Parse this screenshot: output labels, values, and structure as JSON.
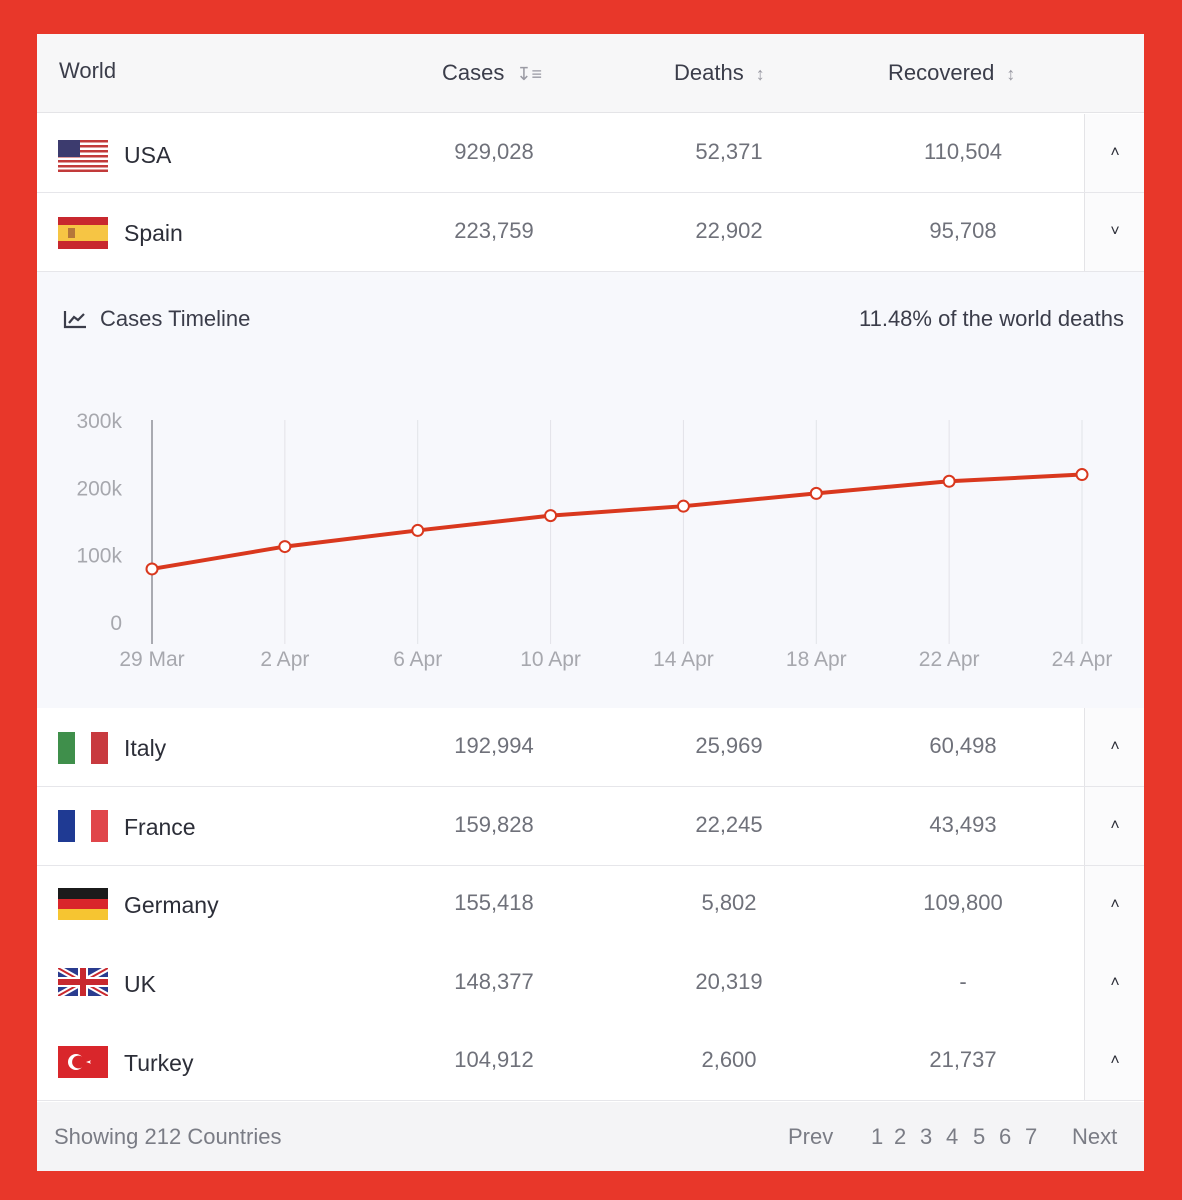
{
  "header": {
    "world": "World",
    "cases": "Cases",
    "deaths": "Deaths",
    "recovered": "Recovered",
    "cases_sort_icon": "sort-descending-icon",
    "deaths_sort_icon": "sort-icon",
    "recovered_sort_icon": "sort-icon"
  },
  "rows": [
    {
      "country": "USA",
      "cases": "929,028",
      "deaths": "52,371",
      "recovered": "110,504",
      "toggle": "˄",
      "flag": "usa-flag-icon"
    },
    {
      "country": "Spain",
      "cases": "223,759",
      "deaths": "22,902",
      "recovered": "95,708",
      "toggle": "˅",
      "flag": "spain-flag-icon"
    },
    {
      "country": "Italy",
      "cases": "192,994",
      "deaths": "25,969",
      "recovered": "60,498",
      "toggle": "˄",
      "flag": "italy-flag-icon"
    },
    {
      "country": "France",
      "cases": "159,828",
      "deaths": "22,245",
      "recovered": "43,493",
      "toggle": "˄",
      "flag": "france-flag-icon"
    },
    {
      "country": "Germany",
      "cases": "155,418",
      "deaths": "5,802",
      "recovered": "109,800",
      "toggle": "˄",
      "flag": "germany-flag-icon"
    },
    {
      "country": "UK",
      "cases": "148,377",
      "deaths": "20,319",
      "recovered": "-",
      "toggle": "˄",
      "flag": "uk-flag-icon"
    },
    {
      "country": "Turkey",
      "cases": "104,912",
      "deaths": "2,600",
      "recovered": "21,737",
      "toggle": "˄",
      "flag": "turkey-flag-icon"
    }
  ],
  "timeline": {
    "title": "Cases Timeline",
    "icon": "line-chart-icon",
    "stat": "11.48% of the world deaths"
  },
  "chart_data": {
    "type": "line",
    "title": "",
    "xlabel": "",
    "ylabel": "",
    "x": [
      "29 Mar",
      "2 Apr",
      "6 Apr",
      "10 Apr",
      "14 Apr",
      "18 Apr",
      "22 Apr",
      "24 Apr"
    ],
    "y_ticks": [
      "0",
      "100k",
      "200k",
      "300k"
    ],
    "ylim": [
      0,
      300000
    ],
    "series": [
      {
        "values": [
          78800,
          112000,
          136000,
          158000,
          172000,
          191000,
          209000,
          219000
        ]
      }
    ],
    "grid": true,
    "color": "#d9381e"
  },
  "footer": {
    "showing": "Showing 212 Countries",
    "prev": "Prev",
    "pages": [
      "1",
      "2",
      "3",
      "4",
      "5",
      "6",
      "7"
    ],
    "next": "Next"
  }
}
